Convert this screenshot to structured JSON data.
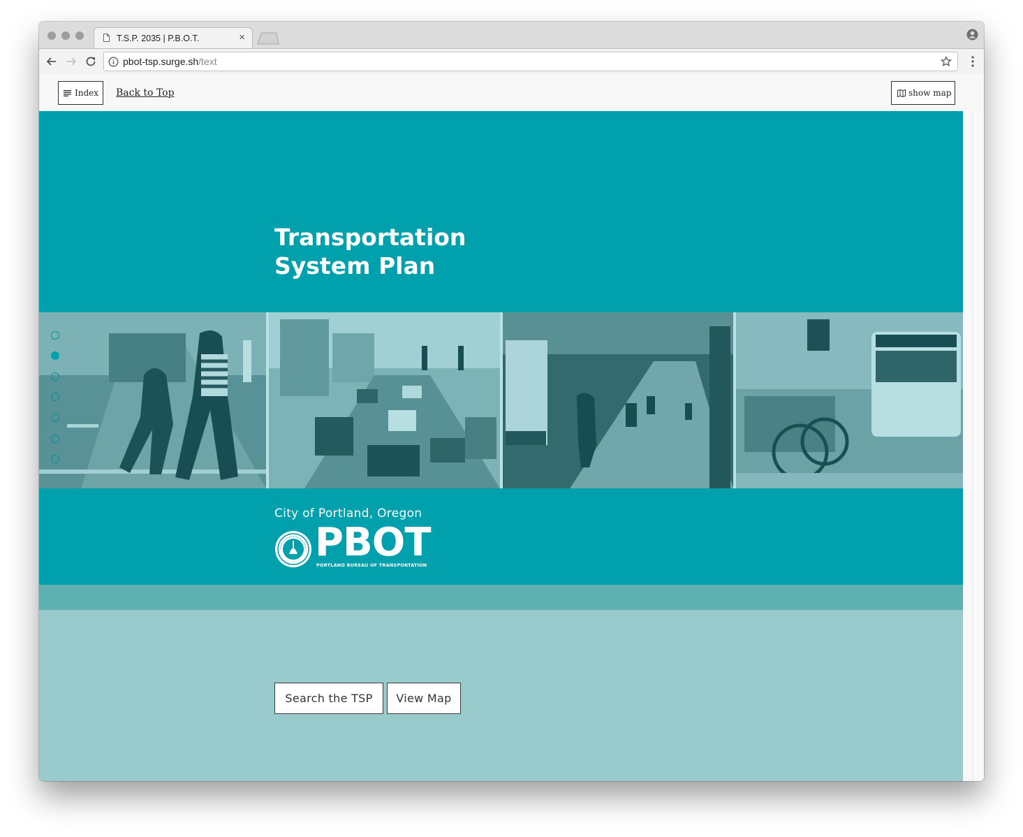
{
  "browser": {
    "tab_title": "T.S.P. 2035 | P.B.O.T.",
    "tab_close": "×",
    "url_host": "pbot-tsp.surge.sh",
    "url_path": "/text"
  },
  "header": {
    "index_label": "Index",
    "back_to_top": "Back to Top",
    "show_map_label": "show map"
  },
  "hero": {
    "title_line1": "Transportation",
    "title_line2": "System Plan",
    "city": "City of Portland, Oregon",
    "logo_word": "PBOT",
    "logo_sub": "PORTLAND BUREAU OF TRANSPORTATION",
    "colors": {
      "teal": "#00a0ad",
      "band": "#5fb0b1",
      "light": "#9acbcc"
    }
  },
  "section_dots": {
    "count": 7,
    "active_index": 1
  },
  "actions": {
    "search_label": "Search the TSP",
    "map_label": "View Map"
  }
}
